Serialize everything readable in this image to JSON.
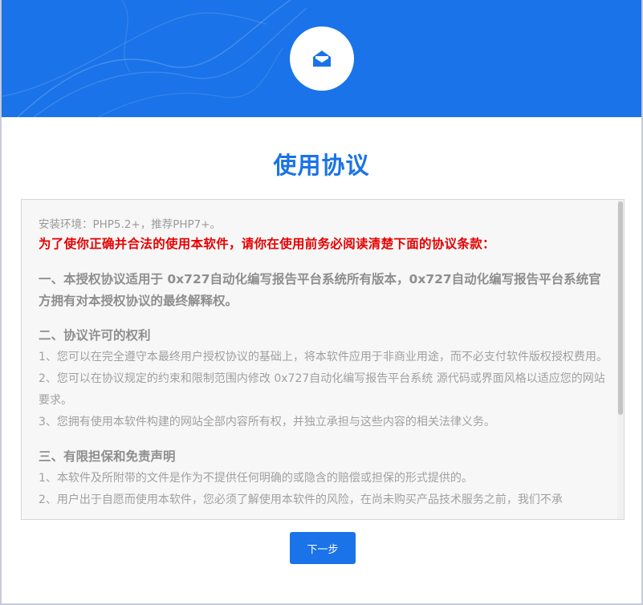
{
  "header": {
    "logo_icon": "open-envelope-icon",
    "background_color": "#1a73e8"
  },
  "page": {
    "title": "使用协议"
  },
  "agreement": {
    "environment": "安装环境：PHP5.2+，推荐PHP7+。",
    "warning": "为了使你正确并合法的使用本软件，请你在使用前务必阅读清楚下面的协议条款：",
    "section1_title": "一、本授权协议适用于 0x727自动化编写报告平台系统所有版本，0x727自动化编写报告平台系统官方拥有对本授权协议的最终解释权。",
    "section2_title": "二、协议许可的权利",
    "section2_items": [
      "1、您可以在完全遵守本最终用户授权协议的基础上，将本软件应用于非商业用途，而不必支付软件版权授权费用。",
      "2、您可以在协议规定的约束和限制范围内修改 0x727自动化编写报告平台系统 源代码或界面风格以适应您的网站要求。",
      "3、您拥有使用本软件构建的网站全部内容所有权，并独立承担与这些内容的相关法律义务。"
    ],
    "section3_title": "三、有限担保和免责声明",
    "section3_items": [
      "1、本软件及所附带的文件是作为不提供任何明确的或隐含的赔偿或担保的形式提供的。",
      "2、用户出于自愿而使用本软件，您必须了解使用本软件的风险，在尚未购买产品技术服务之前，我们不承"
    ]
  },
  "actions": {
    "next_label": "下一步"
  },
  "colors": {
    "accent": "#1a73e8",
    "warning": "#e60000"
  }
}
